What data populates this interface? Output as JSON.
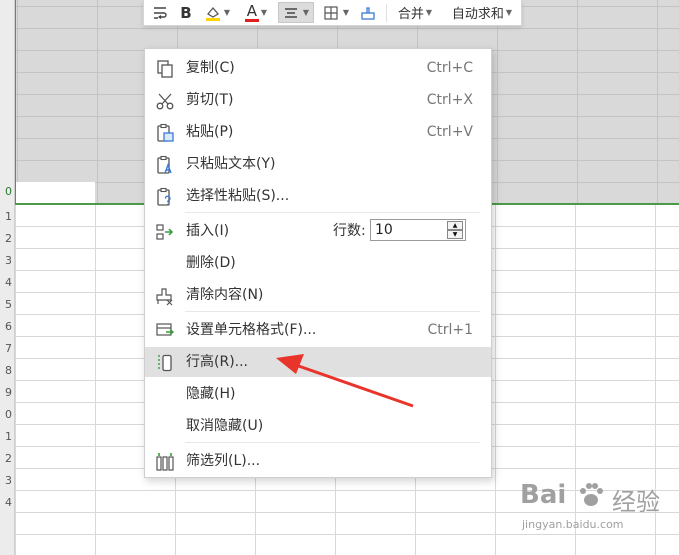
{
  "toolbar": {
    "bold_label": "B",
    "font_color_label": "A",
    "merge_label": "合并",
    "autosum_label": "自动求和",
    "accent_fill": "#ffd400",
    "accent_font": "#e02020"
  },
  "row_headers": [
    "0",
    "1",
    "2",
    "3",
    "4",
    "5",
    "6",
    "7",
    "8",
    "9",
    "0",
    "1",
    "2",
    "3",
    "4"
  ],
  "context_menu": {
    "items": [
      {
        "label": "复制(C)",
        "shortcut": "Ctrl+C",
        "icon": "copy-icon"
      },
      {
        "label": "剪切(T)",
        "shortcut": "Ctrl+X",
        "icon": "scissors-icon"
      },
      {
        "label": "粘贴(P)",
        "shortcut": "Ctrl+V",
        "icon": "paste-icon"
      },
      {
        "label": "只粘贴文本(Y)",
        "shortcut": "",
        "icon": "paste-text-icon"
      },
      {
        "label": "选择性粘贴(S)...",
        "shortcut": "",
        "icon": "paste-special-icon"
      },
      {
        "label": "插入(I)",
        "shortcut": "",
        "icon": "insert-icon"
      },
      {
        "label": "删除(D)",
        "shortcut": "",
        "icon": ""
      },
      {
        "label": "清除内容(N)",
        "shortcut": "",
        "icon": "eraser-icon"
      },
      {
        "label": "设置单元格格式(F)...",
        "shortcut": "Ctrl+1",
        "icon": "format-cells-icon"
      },
      {
        "label": "行高(R)...",
        "shortcut": "",
        "icon": "row-height-icon"
      },
      {
        "label": "隐藏(H)",
        "shortcut": "",
        "icon": ""
      },
      {
        "label": "取消隐藏(U)",
        "shortcut": "",
        "icon": ""
      },
      {
        "label": "筛选列(L)...",
        "shortcut": "",
        "icon": "filter-columns-icon"
      }
    ],
    "highlighted_item": "行高(R)...",
    "insert_rows_label": "行数:",
    "insert_rows_value": "10"
  },
  "annotation": {
    "arrow_color": "#e8342a"
  },
  "watermark": {
    "main": "Bai",
    "logo_text": "经验",
    "url": "jingyan.baidu.com"
  }
}
